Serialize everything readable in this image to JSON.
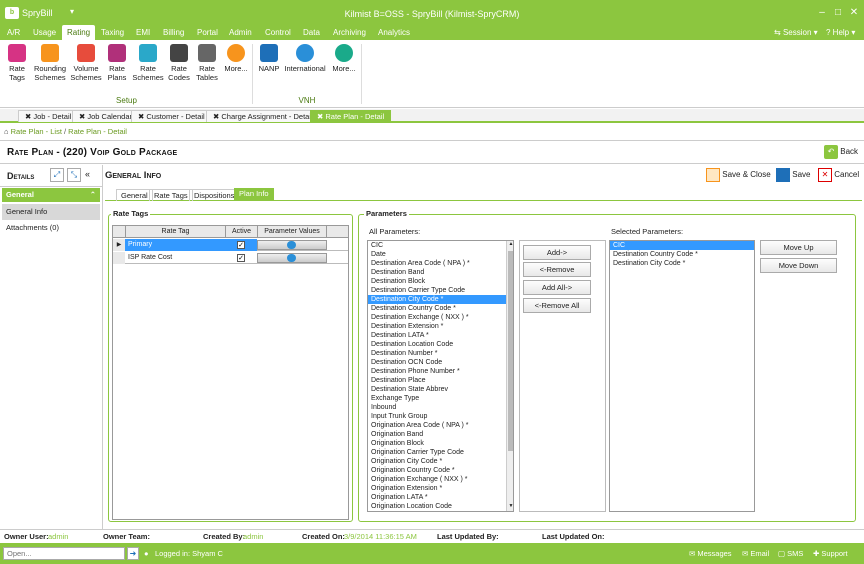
{
  "app": {
    "name": "SpryBill",
    "window_title": "Kilmist B=OSS - SpryBill (Kilmist-SpryCRM)"
  },
  "menu": {
    "items": [
      "A/R",
      "Usage",
      "Rating",
      "Taxing",
      "EMI",
      "Billing",
      "Portal",
      "Admin",
      "Control",
      "Data",
      "Archiving",
      "Analytics"
    ],
    "active": "Rating",
    "session": "Session",
    "help": "Help"
  },
  "ribbon": {
    "setup_group": "Setup",
    "vnh_group": "VNH",
    "buttons": {
      "rate_tags": "Rate Tags",
      "rounding_schemes": "Rounding Schemes",
      "volume_schemes": "Volume Schemes",
      "rate_plans": "Rate Plans",
      "rate_schemes": "Rate Schemes",
      "rate_codes": "Rate Codes",
      "rate_tables": "Rate Tables",
      "more1": "More...",
      "nanp": "NANP",
      "international": "International",
      "more2": "More..."
    }
  },
  "doc_tabs": [
    {
      "label": "Job - Detail"
    },
    {
      "label": "Job Calendar"
    },
    {
      "label": "Customer - Detail"
    },
    {
      "label": "Charge Assignment - Detail"
    },
    {
      "label": "Rate Plan - Detail"
    }
  ],
  "breadcrumbs": {
    "first": "Rate Plan - List",
    "second": "Rate Plan - Detail"
  },
  "page": {
    "title": "Rate Plan - (220) Voip Gold Package",
    "back": "Back"
  },
  "sidebar": {
    "title": "Details",
    "section": "General",
    "items": [
      "General Info",
      "Attachments (0)"
    ]
  },
  "main": {
    "title": "General Info",
    "save_close": "Save & Close",
    "save": "Save",
    "cancel": "Cancel",
    "tabs": [
      "General",
      "Rate Tags",
      "Dispositions",
      "Plan Info"
    ],
    "active_tab": "Plan Info"
  },
  "rate_tags": {
    "legend": "Rate Tags",
    "columns": [
      "Rate Tag",
      "Active",
      "Parameter Values"
    ],
    "rows": [
      {
        "tag": "Primary",
        "active": true
      },
      {
        "tag": "ISP Rate Cost",
        "active": true
      }
    ]
  },
  "parameters": {
    "legend": "Parameters",
    "all_label": "All Parameters:",
    "selected_label": "Selected Parameters:",
    "all": [
      "CIC",
      "Date",
      "Destination Area Code ( NPA ) *",
      "Destination Band",
      "Destination Block",
      "Destination Carrier Type Code",
      "Destination City Code *",
      "Destination Country Code *",
      "Destination Exchange ( NXX ) *",
      "Destination Extension *",
      "Destination LATA *",
      "Destination Location Code",
      "Destination Number *",
      "Destination OCN Code",
      "Destination Phone Number *",
      "Destination Place",
      "Destination State Abbrev",
      "Exchange Type",
      "Inbound",
      "Input Trunk Group",
      "Origination Area Code ( NPA ) *",
      "Origination Band",
      "Origination Block",
      "Origination Carrier Type Code",
      "Origination City Code *",
      "Origination Country Code *",
      "Origination Exchange ( NXX ) *",
      "Origination Extension *",
      "Origination LATA *",
      "Origination Location Code"
    ],
    "all_selected": "Destination City Code *",
    "selected": [
      "CIC",
      "Destination Country Code *",
      "Destination City Code *"
    ],
    "selected_highlight": "CIC",
    "add": "Add->",
    "remove": "<-Remove",
    "add_all": "Add All->",
    "remove_all": "<-Remove All",
    "move_up": "Move Up",
    "move_down": "Move Down"
  },
  "status": {
    "owner_user_label": "Owner User:",
    "owner_user": "admin",
    "owner_team_label": "Owner Team:",
    "created_by_label": "Created By:",
    "created_by": "admin",
    "created_on_label": "Created On:",
    "created_on": "3/9/2014 11:36:15 AM",
    "last_updated_by_label": "Last Updated By:",
    "last_updated_on_label": "Last Updated On:"
  },
  "bottom": {
    "open_placeholder": "Open...",
    "logged_in": "Logged in: Shyam C",
    "messages": "Messages",
    "email": "Email",
    "sms": "SMS",
    "support": "Support"
  },
  "colors": {
    "accent": "#8cc63f",
    "selection": "#3399ff",
    "gear_blue": "#2a8fd8"
  }
}
